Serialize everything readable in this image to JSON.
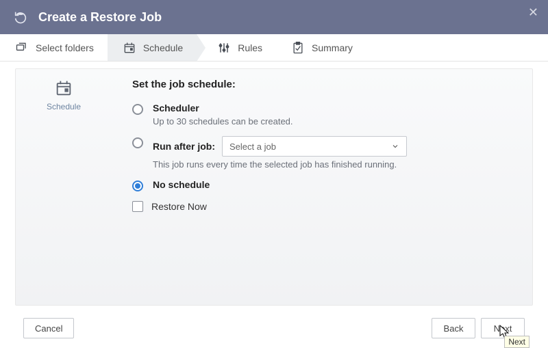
{
  "header": {
    "title": "Create a Restore Job"
  },
  "steps": {
    "select_folders": "Select folders",
    "schedule": "Schedule",
    "rules": "Rules",
    "summary": "Summary"
  },
  "side": {
    "label": "Schedule"
  },
  "form": {
    "section_title": "Set the job schedule:",
    "scheduler": {
      "label": "Scheduler",
      "desc": "Up to 30 schedules can be created."
    },
    "run_after": {
      "label": "Run after job:",
      "select_placeholder": "Select a job",
      "desc": "This job runs every time the selected job has finished running."
    },
    "no_schedule": {
      "label": "No schedule",
      "selected": true
    },
    "restore_now": {
      "label": "Restore Now",
      "checked": false
    }
  },
  "footer": {
    "cancel": "Cancel",
    "back": "Back",
    "next": "Next"
  },
  "tooltip": "Next"
}
